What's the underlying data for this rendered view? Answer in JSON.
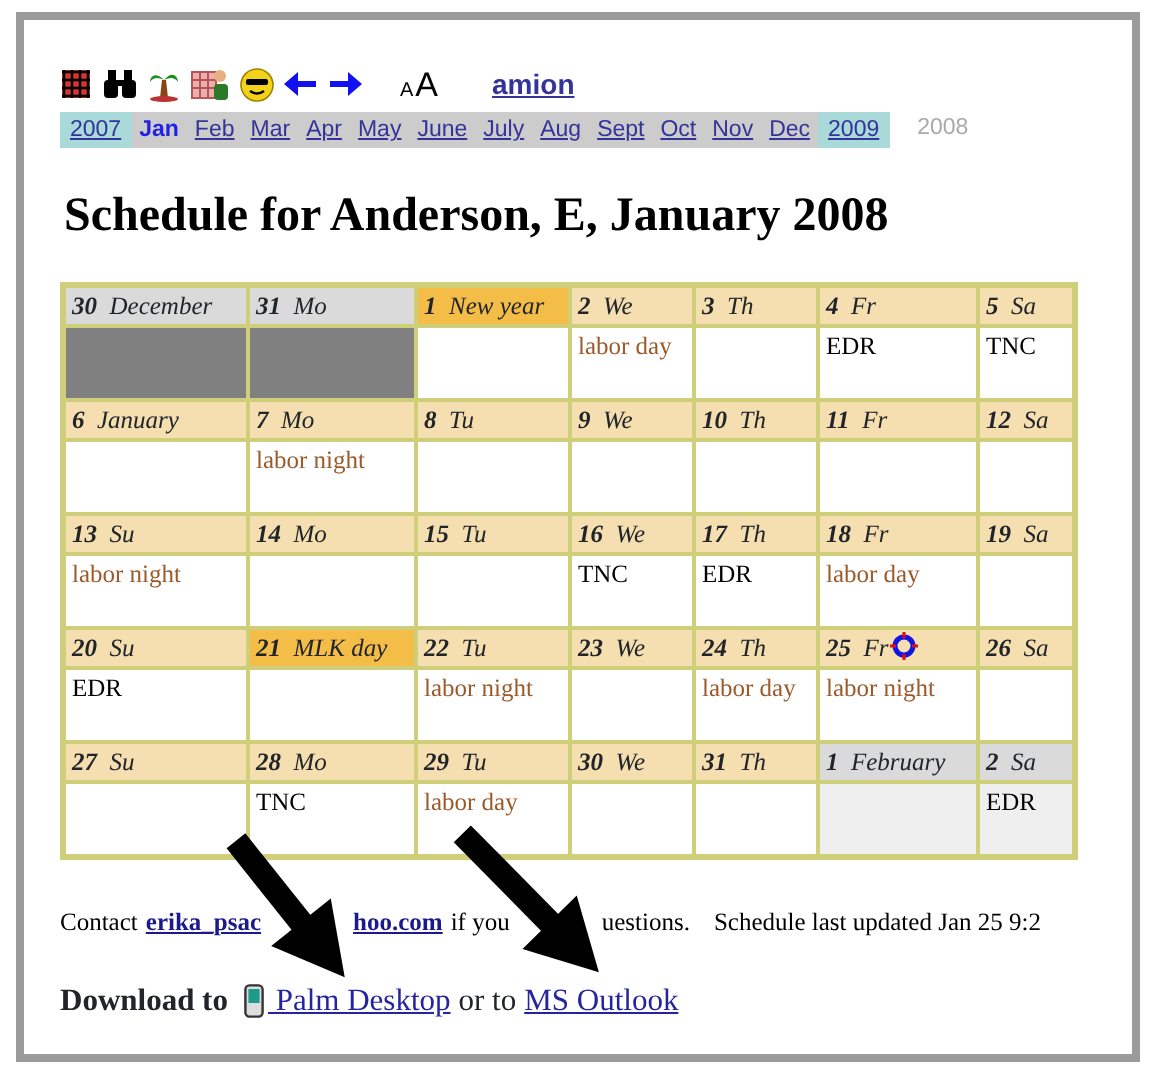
{
  "toolbar": {
    "font_size_labels": [
      "A",
      "A"
    ],
    "site_link": "amion"
  },
  "month_nav": {
    "items": [
      {
        "text": "2007",
        "kind": "year",
        "selected": false
      },
      {
        "text": "Jan",
        "kind": "month",
        "selected": true
      },
      {
        "text": "Feb",
        "kind": "month",
        "selected": false
      },
      {
        "text": "Mar",
        "kind": "month",
        "selected": false
      },
      {
        "text": "Apr",
        "kind": "month",
        "selected": false
      },
      {
        "text": "May",
        "kind": "month",
        "selected": false
      },
      {
        "text": "June",
        "kind": "month",
        "selected": false
      },
      {
        "text": "July",
        "kind": "month",
        "selected": false
      },
      {
        "text": "Aug",
        "kind": "month",
        "selected": false
      },
      {
        "text": "Sept",
        "kind": "month",
        "selected": false
      },
      {
        "text": "Oct",
        "kind": "month",
        "selected": false
      },
      {
        "text": "Nov",
        "kind": "month",
        "selected": false
      },
      {
        "text": "Dec",
        "kind": "month",
        "selected": false
      },
      {
        "text": "2009",
        "kind": "year",
        "selected": false
      }
    ],
    "current_year": "2008"
  },
  "title": "Schedule for Anderson, E, January 2008",
  "weeks": [
    [
      {
        "number": "30",
        "label": "December",
        "kind": "outside_dark"
      },
      {
        "number": "31",
        "label": "Mo",
        "kind": "outside_dark"
      },
      {
        "number": "1",
        "label": "New year",
        "kind": "holiday"
      },
      {
        "number": "2",
        "label": "We",
        "kind": "normal",
        "entries": [
          {
            "text": "labor day",
            "kind": "labor"
          }
        ]
      },
      {
        "number": "3",
        "label": "Th",
        "kind": "normal"
      },
      {
        "number": "4",
        "label": "Fr",
        "kind": "normal",
        "entries": [
          {
            "text": "EDR",
            "kind": "shift"
          }
        ]
      },
      {
        "number": "5",
        "label": "Sa",
        "kind": "normal",
        "entries": [
          {
            "text": "TNC",
            "kind": "shift"
          }
        ]
      }
    ],
    [
      {
        "number": "6",
        "label": "January",
        "kind": "normal"
      },
      {
        "number": "7",
        "label": "Mo",
        "kind": "normal",
        "entries": [
          {
            "text": "labor night",
            "kind": "labor"
          }
        ]
      },
      {
        "number": "8",
        "label": "Tu",
        "kind": "normal"
      },
      {
        "number": "9",
        "label": "We",
        "kind": "normal"
      },
      {
        "number": "10",
        "label": "Th",
        "kind": "normal"
      },
      {
        "number": "11",
        "label": "Fr",
        "kind": "normal"
      },
      {
        "number": "12",
        "label": "Sa",
        "kind": "normal"
      }
    ],
    [
      {
        "number": "13",
        "label": "Su",
        "kind": "normal",
        "entries": [
          {
            "text": "labor night",
            "kind": "labor"
          }
        ]
      },
      {
        "number": "14",
        "label": "Mo",
        "kind": "normal"
      },
      {
        "number": "15",
        "label": "Tu",
        "kind": "normal"
      },
      {
        "number": "16",
        "label": "We",
        "kind": "normal",
        "entries": [
          {
            "text": "TNC",
            "kind": "shift"
          }
        ]
      },
      {
        "number": "17",
        "label": "Th",
        "kind": "normal",
        "entries": [
          {
            "text": "EDR",
            "kind": "shift"
          }
        ]
      },
      {
        "number": "18",
        "label": "Fr",
        "kind": "normal",
        "entries": [
          {
            "text": "labor day",
            "kind": "labor"
          }
        ]
      },
      {
        "number": "19",
        "label": "Sa",
        "kind": "normal"
      }
    ],
    [
      {
        "number": "20",
        "label": "Su",
        "kind": "normal",
        "entries": [
          {
            "text": "EDR",
            "kind": "shift"
          }
        ]
      },
      {
        "number": "21",
        "label": "MLK day",
        "kind": "holiday"
      },
      {
        "number": "22",
        "label": "Tu",
        "kind": "normal",
        "entries": [
          {
            "text": "labor night",
            "kind": "labor"
          }
        ]
      },
      {
        "number": "23",
        "label": "We",
        "kind": "normal"
      },
      {
        "number": "24",
        "label": "Th",
        "kind": "normal",
        "entries": [
          {
            "text": "labor day",
            "kind": "labor"
          }
        ]
      },
      {
        "number": "25",
        "label": "Fr",
        "kind": "normal",
        "flagged": true,
        "entries": [
          {
            "text": "labor night",
            "kind": "labor"
          }
        ]
      },
      {
        "number": "26",
        "label": "Sa",
        "kind": "normal"
      }
    ],
    [
      {
        "number": "27",
        "label": "Su",
        "kind": "normal"
      },
      {
        "number": "28",
        "label": "Mo",
        "kind": "normal",
        "entries": [
          {
            "text": "TNC",
            "kind": "shift"
          }
        ]
      },
      {
        "number": "29",
        "label": "Tu",
        "kind": "normal",
        "entries": [
          {
            "text": "labor day",
            "kind": "labor"
          }
        ]
      },
      {
        "number": "30",
        "label": "We",
        "kind": "normal"
      },
      {
        "number": "31",
        "label": "Th",
        "kind": "normal"
      },
      {
        "number": "1",
        "label": "February",
        "kind": "outside_light"
      },
      {
        "number": "2",
        "label": "Sa",
        "kind": "outside_light",
        "entries": [
          {
            "text": "EDR",
            "kind": "shift"
          }
        ]
      }
    ]
  ],
  "contact": {
    "prefix": "Contact",
    "email_start": "erika_psac",
    "email_end": "hoo.com",
    "middle": "if you",
    "end": "uestions.",
    "updated": "Schedule last updated Jan 25 9:2"
  },
  "download": {
    "label": "Download to",
    "palm_link": "Palm Desktop",
    "joiner": "or to",
    "outlook_link": "MS Outlook"
  }
}
